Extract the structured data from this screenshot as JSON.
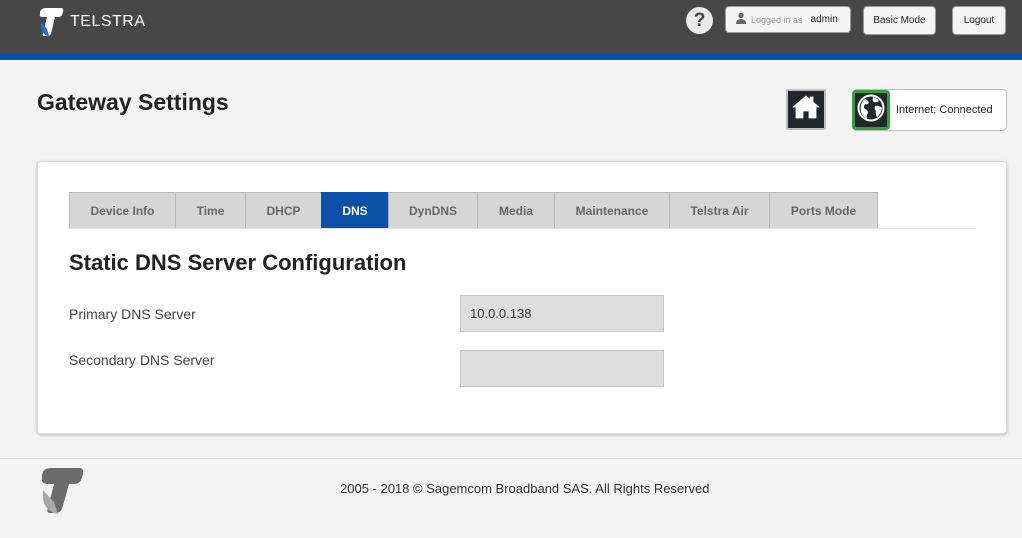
{
  "header": {
    "brand": "TELSTRA",
    "help_label": "?",
    "logged_in_label": "Logged in as",
    "username": "admin",
    "basic_mode_label": "Basic Mode",
    "logout_label": "Logout"
  },
  "page": {
    "title": "Gateway Settings",
    "internet_status": "Internet: Connected"
  },
  "tabs": [
    {
      "label": "Device Info",
      "active": false
    },
    {
      "label": "Time",
      "active": false
    },
    {
      "label": "DHCP",
      "active": false
    },
    {
      "label": "DNS",
      "active": true
    },
    {
      "label": "DynDNS",
      "active": false
    },
    {
      "label": "Media",
      "active": false
    },
    {
      "label": "Maintenance",
      "active": false
    },
    {
      "label": "Telstra Air",
      "active": false
    },
    {
      "label": "Ports Mode",
      "active": false
    }
  ],
  "dns": {
    "section_title": "Static DNS Server Configuration",
    "primary_label": "Primary DNS Server",
    "primary_value": "10.0.0.138",
    "secondary_label": "Secondary DNS Server",
    "secondary_value": ""
  },
  "footer": {
    "copyright": "2005 - 2018 © Sagemcom Broadband SAS. All Rights Reserved"
  },
  "icons": {
    "brand_logo": "telstra-t-logo",
    "user": "user-icon",
    "home": "home-icon",
    "internet": "globe-icon",
    "footer_logo": "telstra-t-logo"
  },
  "colors": {
    "topbar": "#474747",
    "accent_blue": "#0a4fa8",
    "connected_green": "#35a03a"
  }
}
